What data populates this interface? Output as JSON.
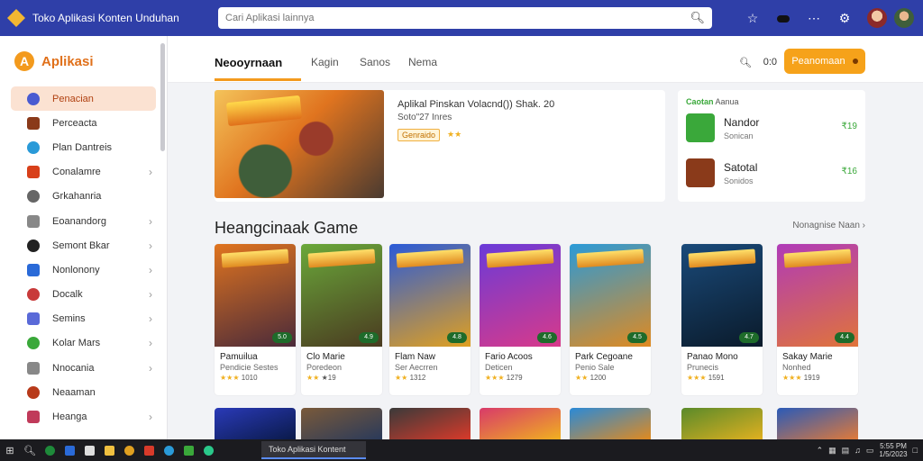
{
  "titlebar": {
    "title": "Toko Aplikasi Konten Unduhan",
    "search_placeholder": "Cari Aplikasi lainnya",
    "icons": [
      "star-icon",
      "toggle-icon",
      "more-icon",
      "gear-icon"
    ]
  },
  "sidebar": {
    "brand": "Aplikasi",
    "brand_letter": "A",
    "items": [
      {
        "label": "Penacian",
        "active": true,
        "color": "#4a5bd1",
        "chevron": false
      },
      {
        "label": "Perceacta",
        "active": false,
        "color": "#8a3a1a",
        "chevron": false
      },
      {
        "label": "Plan Dantreis",
        "active": false,
        "color": "#2a9ad8",
        "chevron": false
      },
      {
        "label": "Conalamre",
        "active": false,
        "color": "#d8401a",
        "chevron": true
      },
      {
        "label": "Grkahanria",
        "active": false,
        "color": "#666666",
        "chevron": false
      },
      {
        "label": "Eoanandorg",
        "active": false,
        "color": "#888888",
        "chevron": true
      },
      {
        "label": "Semont Bkar",
        "active": false,
        "color": "#222222",
        "chevron": true
      },
      {
        "label": "Nonlonony",
        "active": false,
        "color": "#2a6ad8",
        "chevron": true
      },
      {
        "label": "Docalk",
        "active": false,
        "color": "#c83a3a",
        "chevron": true
      },
      {
        "label": "Semins",
        "active": false,
        "color": "#5a6ad8",
        "chevron": true
      },
      {
        "label": "Kolar Mars",
        "active": false,
        "color": "#3aa83a",
        "chevron": true
      },
      {
        "label": "Nnocania",
        "active": false,
        "color": "#888888",
        "chevron": true
      },
      {
        "label": "Neaaman",
        "active": false,
        "color": "#b83a1a",
        "chevron": false
      },
      {
        "label": "Heanga",
        "active": false,
        "color": "#c03a5a",
        "chevron": true
      }
    ]
  },
  "topnav": {
    "tabs": [
      "Neooyrnaan",
      "Kagin",
      "Sanos",
      "Nema"
    ],
    "search_value": "0:0",
    "button_label": "Peanomaan"
  },
  "hero": {
    "title": "Aplikal Pinskan Volacnd()) Shak. 20",
    "subtitle": "Soto\"27 Inres",
    "badge": "Genraido",
    "stars": "★★"
  },
  "side_card": {
    "head_accent": "Caotan",
    "head_rest": "Aanua",
    "rows": [
      {
        "name": "Nandor",
        "meta": "Sonican",
        "price": "₹19",
        "color": "#3aa83a"
      },
      {
        "name": "Satotal",
        "meta": "Sonidos",
        "price": "₹16",
        "color": "#8a3a1a"
      }
    ]
  },
  "section": {
    "title": "Heangcinaak Game",
    "more": "Nonagnise Naan ›"
  },
  "cards": [
    {
      "name": "Pamuilua",
      "sub": "Pendicie Sestes",
      "rating": "1010",
      "stars": "★★★",
      "badge": "5.0",
      "c1": "#e0741f",
      "c2": "#4a2a3a"
    },
    {
      "name": "Clo Marie",
      "sub": "Poredeon",
      "rating": "★19",
      "stars": "★★",
      "badge": "4.9",
      "c1": "#6aa83a",
      "c2": "#4a3a20"
    },
    {
      "name": "Flam Naw",
      "sub": "Ser Aecrren",
      "rating": "1312",
      "stars": "★★",
      "badge": "4.8",
      "c1": "#2a5ad8",
      "c2": "#e0a020"
    },
    {
      "name": "Fario Acoos",
      "sub": "Deticen",
      "rating": "1279",
      "stars": "★★★",
      "badge": "4.6",
      "c1": "#6a3ad8",
      "c2": "#d83a8a"
    },
    {
      "name": "Park Cegoane",
      "sub": "Penio Sale",
      "rating": "1200",
      "stars": "★★",
      "badge": "4.5",
      "c1": "#2a9ad8",
      "c2": "#e08a20"
    },
    {
      "name": "Panao Mono",
      "sub": "Prunecis",
      "rating": "1591",
      "stars": "★★★",
      "badge": "4.7",
      "c1": "#1a4a7a",
      "c2": "#0a1a2a"
    },
    {
      "name": "Sakay Marie",
      "sub": "Nonhed",
      "rating": "1919",
      "stars": "★★★",
      "badge": "4.4",
      "c1": "#b03ab8",
      "c2": "#e0743a"
    }
  ],
  "row2_colors": [
    [
      "#2a3ab8",
      "#0a1a4a"
    ],
    [
      "#7a5a3a",
      "#2a3a5a"
    ],
    [
      "#3a3a3a",
      "#d83a2a"
    ],
    [
      "#d83a6a",
      "#f0b020"
    ],
    [
      "#2a8ad8",
      "#e08a20"
    ],
    [
      "#5a8a2a",
      "#e0b020"
    ],
    [
      "#2a5ab8",
      "#e07a3a"
    ]
  ],
  "taskbar": {
    "active_window": "Toko Aplikasi Kontent",
    "clock": "5:55 PM",
    "date": "1/5/2023"
  }
}
